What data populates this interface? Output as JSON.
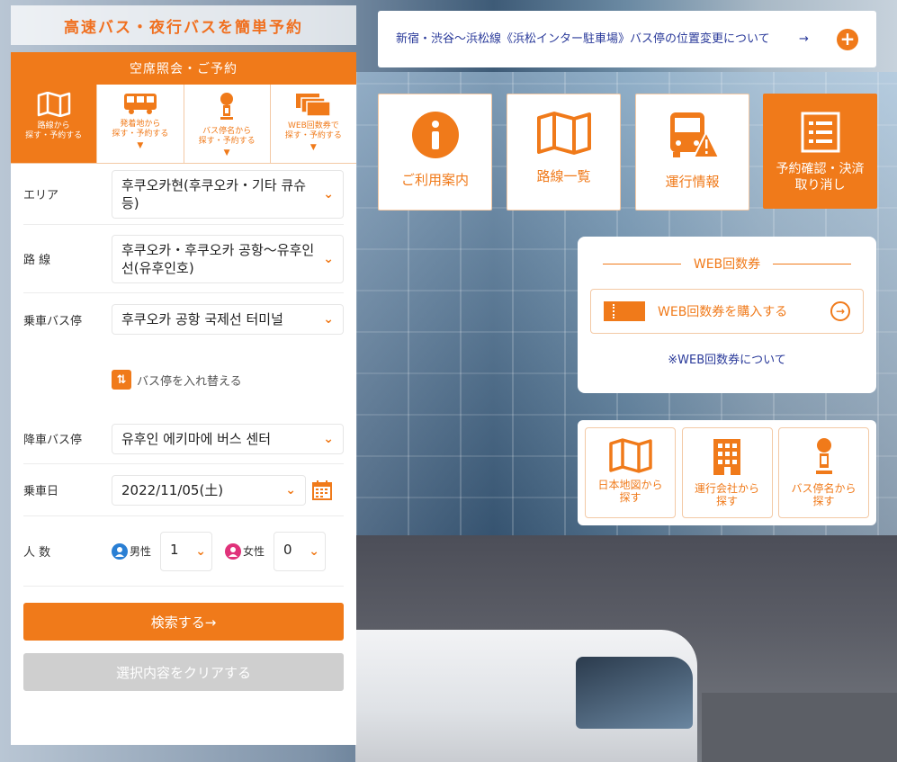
{
  "brand": {
    "banner": "高速バス・夜行バスを簡単予約"
  },
  "notice": {
    "text": "新宿・渋谷～浜松線《浜松インター駐車場》バス停の位置変更について",
    "arrow": "→",
    "plus": "+"
  },
  "panel": {
    "header": "空席照会・ご予約",
    "tabs": [
      {
        "label": "路線から\n探す・予約する",
        "active": true
      },
      {
        "label": "発着地から\n探す・予約する",
        "caret": "▼"
      },
      {
        "label": "バス停名から\n探す・予約する",
        "caret": "▼"
      },
      {
        "label": "WEB回数券で\n探す・予約する",
        "caret": "▼"
      }
    ],
    "fields": {
      "area": {
        "label": "エリア",
        "value": "후쿠오카현(후쿠오카・기타 큐슈 등)"
      },
      "route": {
        "label": "路 線",
        "value": "후쿠오카・후쿠오카 공항～유후인선(유후인호)"
      },
      "boarding": {
        "label": "乗車バス停",
        "value": "후쿠오카 공항 국제선 터미널"
      },
      "swap": "バス停を入れ替える",
      "alighting": {
        "label": "降車バス停",
        "value": "유후인 에키마에 버스 센터"
      },
      "date": {
        "label": "乗車日",
        "value": "2022/11/05(土)"
      },
      "people": {
        "label": "人 数",
        "male_label": "男性",
        "male_value": "1",
        "female_label": "女性",
        "female_value": "0"
      }
    },
    "search_button": "検索する→",
    "clear_button": "選択内容をクリアする"
  },
  "quick": {
    "guide": "ご利用案内",
    "routes": "路線一覧",
    "operation": "運行情報",
    "reservation": "予約確認・決済\n取り消し"
  },
  "web_card": {
    "title": "WEB回数券",
    "buy": "WEB回数券を購入する",
    "about": "※WEB回数券について"
  },
  "tiles": {
    "map": "日本地図から\n探す",
    "company": "運行会社から\n探す",
    "stop": "バス停名から\n探す"
  },
  "colors": {
    "accent": "#f07a1a",
    "link": "#2a3a9a"
  }
}
